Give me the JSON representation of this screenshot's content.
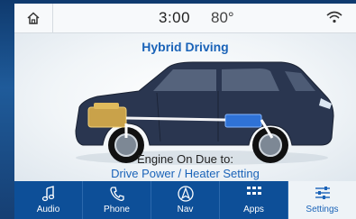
{
  "status": {
    "time": "3:00",
    "temperature": "80°"
  },
  "screen": {
    "title": "Hybrid Driving",
    "message_line1": "Engine On Due to:",
    "message_line2": "Drive Power / Heater Setting"
  },
  "nav": [
    {
      "label": "Audio",
      "icon": "music-note-icon"
    },
    {
      "label": "Phone",
      "icon": "phone-icon"
    },
    {
      "label": "Nav",
      "icon": "navigation-icon"
    },
    {
      "label": "Apps",
      "icon": "apps-grid-icon"
    },
    {
      "label": "Settings",
      "icon": "settings-sliders-icon",
      "active": true
    }
  ],
  "colors": {
    "accent": "#1a63b8",
    "navbar": "#0d4f98",
    "engine": "#c9a24a",
    "battery": "#2f72d6"
  }
}
